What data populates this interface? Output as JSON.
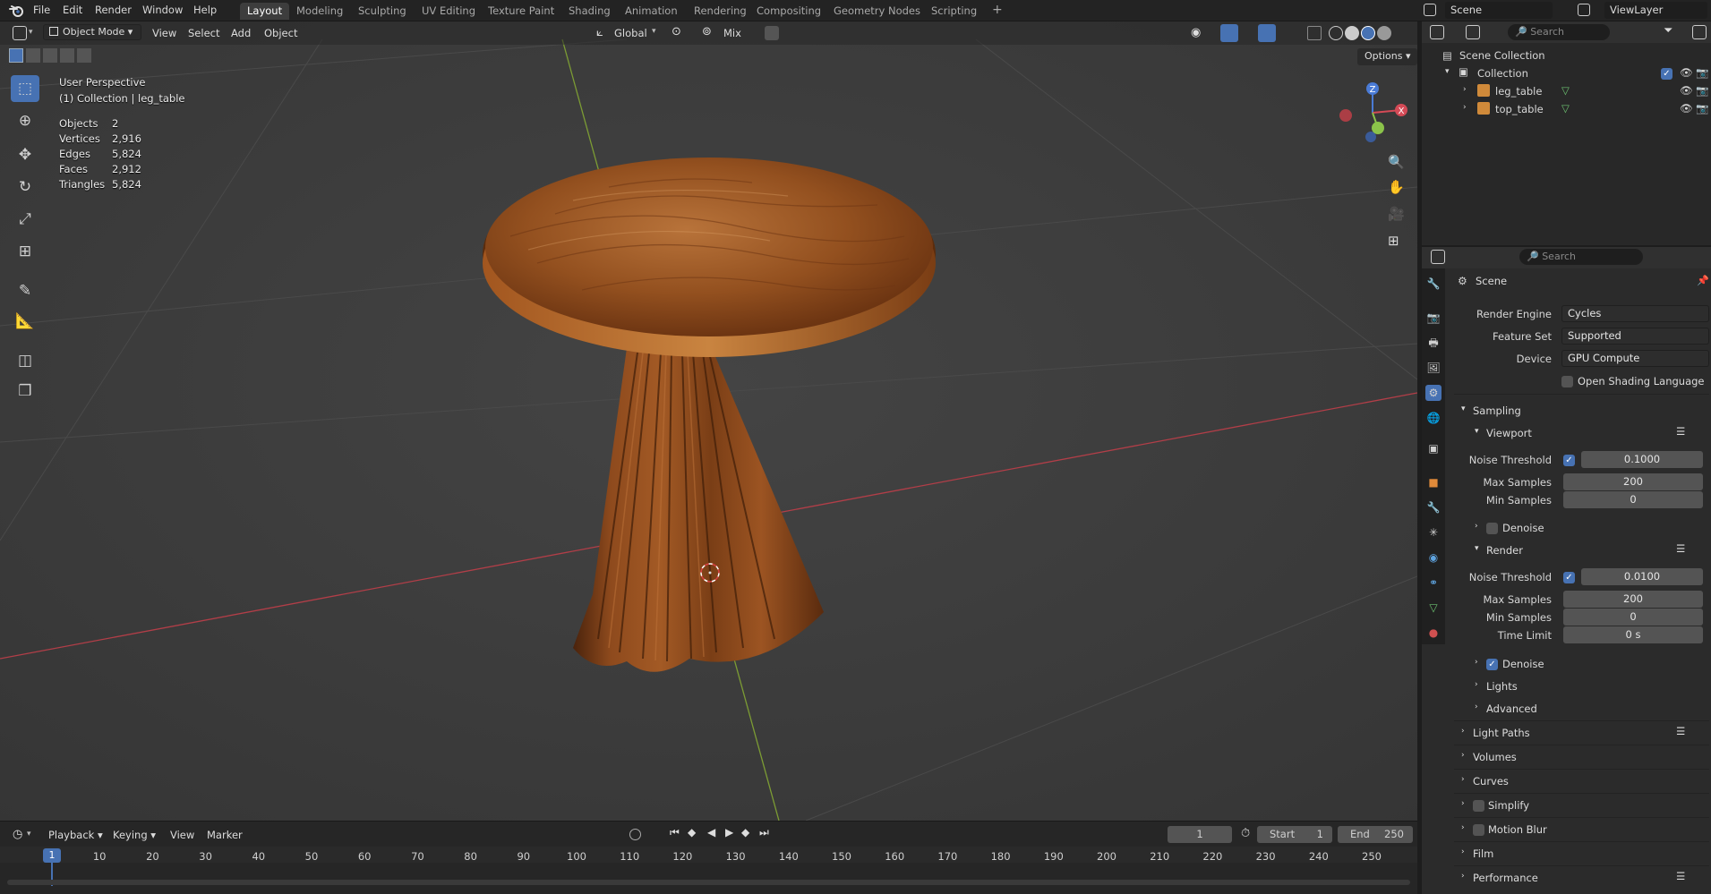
{
  "topbar": {
    "menus": [
      "File",
      "Edit",
      "Render",
      "Window",
      "Help"
    ],
    "workspaces": [
      "Layout",
      "Modeling",
      "Sculpting",
      "UV Editing",
      "Texture Paint",
      "Shading",
      "Animation",
      "Rendering",
      "Compositing",
      "Geometry Nodes",
      "Scripting"
    ],
    "add_tab": "+",
    "scene_name": "Scene",
    "view_layer": "ViewLayer"
  },
  "viewport_header": {
    "mode": "Object Mode",
    "menus": [
      "View",
      "Select",
      "Add",
      "Object"
    ],
    "orientation": "Global",
    "snap": "Mix",
    "options": "Options"
  },
  "overlay": {
    "perspective": "User Perspective",
    "context": "(1) Collection | leg_table",
    "stats": [
      {
        "label": "Objects",
        "value": "2"
      },
      {
        "label": "Vertices",
        "value": "2,916"
      },
      {
        "label": "Edges",
        "value": "5,824"
      },
      {
        "label": "Faces",
        "value": "2,912"
      },
      {
        "label": "Triangles",
        "value": "5,824"
      }
    ]
  },
  "gizmo": {
    "x": "X",
    "y": "Y",
    "z": "Z"
  },
  "outliner": {
    "search_placeholder": "Search",
    "root": "Scene Collection",
    "collection": "Collection",
    "objects": [
      "leg_table",
      "top_table"
    ]
  },
  "properties": {
    "search_placeholder": "Search",
    "context": "Scene",
    "render_engine_label": "Render Engine",
    "render_engine": "Cycles",
    "feature_set_label": "Feature Set",
    "feature_set": "Supported",
    "device_label": "Device",
    "device": "GPU Compute",
    "osl_label": "Open Shading Language",
    "sampling": "Sampling",
    "viewport": "Viewport",
    "vp_noise_label": "Noise Threshold",
    "vp_noise": "0.1000",
    "vp_max_label": "Max Samples",
    "vp_max": "200",
    "vp_min_label": "Min Samples",
    "vp_min": "0",
    "vp_denoise": "Denoise",
    "render": "Render",
    "r_noise_label": "Noise Threshold",
    "r_noise": "0.0100",
    "r_max_label": "Max Samples",
    "r_max": "200",
    "r_min_label": "Min Samples",
    "r_min": "0",
    "r_time_label": "Time Limit",
    "r_time": "0 s",
    "r_denoise": "Denoise",
    "lights": "Lights",
    "advanced": "Advanced",
    "light_paths": "Light Paths",
    "volumes": "Volumes",
    "curves": "Curves",
    "simplify": "Simplify",
    "motion_blur": "Motion Blur",
    "film": "Film",
    "performance": "Performance"
  },
  "timeline": {
    "menus": [
      "Playback",
      "Keying",
      "View",
      "Marker"
    ],
    "current_frame": "1",
    "start_label": "Start",
    "start": "1",
    "end_label": "End",
    "end": "250",
    "ruler": [
      "10",
      "20",
      "30",
      "40",
      "50",
      "60",
      "70",
      "80",
      "90",
      "100",
      "110",
      "120",
      "130",
      "140",
      "150",
      "160",
      "170",
      "180",
      "190",
      "200",
      "210",
      "220",
      "230",
      "240",
      "250"
    ],
    "playhead": "1"
  },
  "colors": {
    "accent": "#4772b3",
    "x_axis": "#c83c4a",
    "y_axis": "#7fa23a",
    "wood": "#8a4a1e"
  }
}
